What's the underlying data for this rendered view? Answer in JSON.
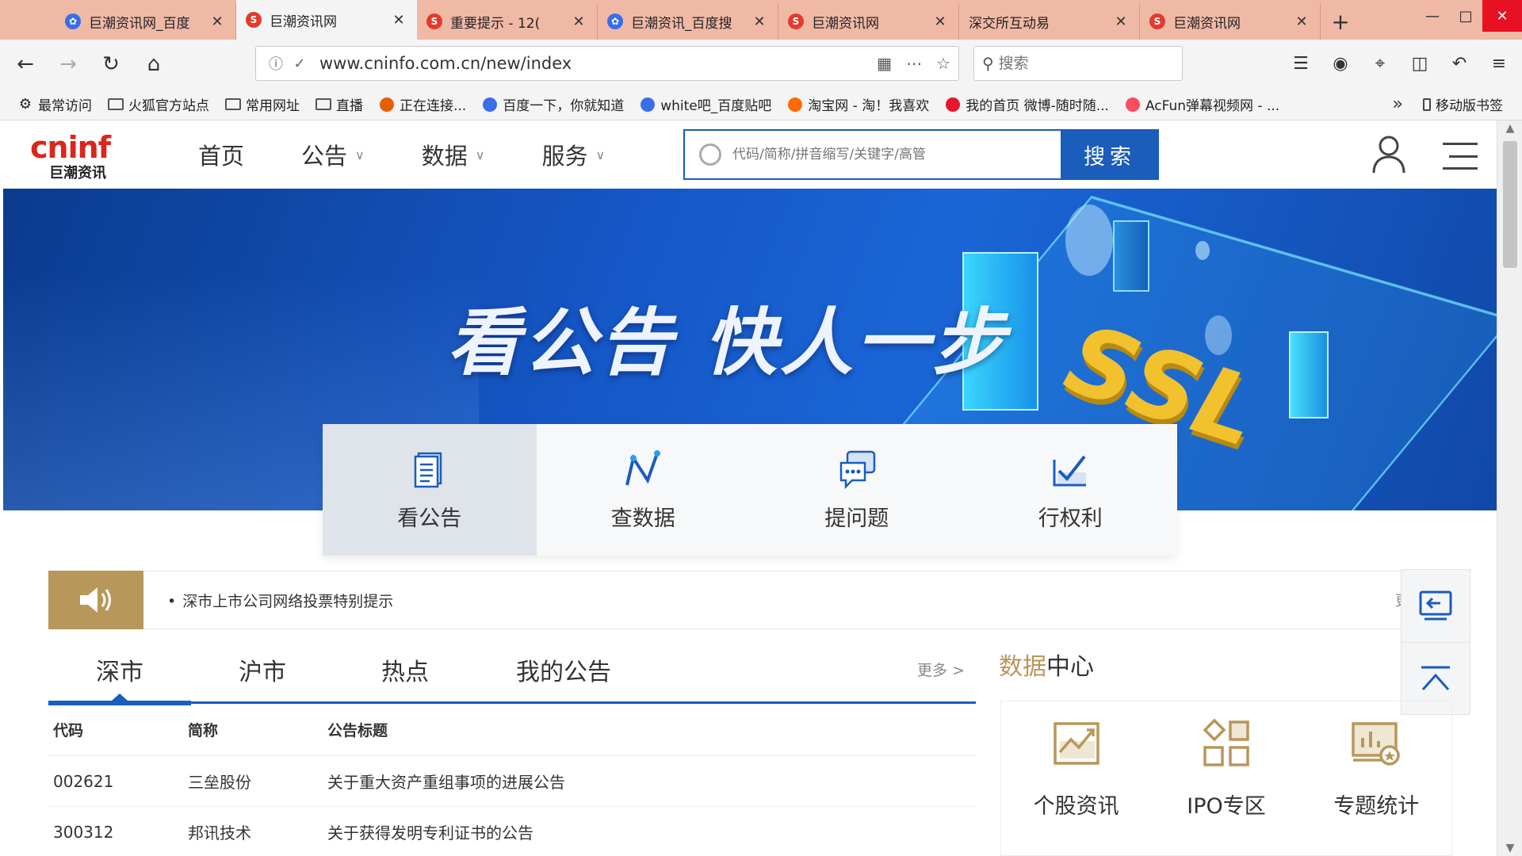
{
  "browser": {
    "tabs": [
      {
        "title": "巨潮资讯网_百度",
        "icon": "baidu",
        "active": false
      },
      {
        "title": "巨潮资讯网",
        "icon": "cninfo",
        "active": true
      },
      {
        "title": "重要提示 - 12(",
        "icon": "cninfo",
        "active": false
      },
      {
        "title": "巨潮资讯_百度搜",
        "icon": "baidu",
        "active": false
      },
      {
        "title": "巨潮资讯网",
        "icon": "cninfo",
        "active": false
      },
      {
        "title": "深交所互动易",
        "icon": "none",
        "active": false
      },
      {
        "title": "巨潮资讯网",
        "icon": "cninfo",
        "active": false
      }
    ],
    "new_tab": "+",
    "url": "www.cninfo.com.cn/new/index",
    "search_placeholder": "搜索",
    "bookmarks": [
      {
        "label": "最常访问",
        "icon": "gear"
      },
      {
        "label": "火狐官方站点",
        "icon": "folder"
      },
      {
        "label": "常用网址",
        "icon": "folder"
      },
      {
        "label": "直播",
        "icon": "folder"
      },
      {
        "label": "正在连接...",
        "icon": "firefox"
      },
      {
        "label": "百度一下，你就知道",
        "icon": "baidu"
      },
      {
        "label": "white吧_百度贴吧",
        "icon": "baidu"
      },
      {
        "label": "淘宝网 - 淘！我喜欢",
        "icon": "taobao"
      },
      {
        "label": "我的首页 微博-随时随...",
        "icon": "weibo"
      },
      {
        "label": "AcFun弹幕视频网 - ...",
        "icon": "acfun"
      }
    ],
    "bookmarks_more": "»",
    "mobile_bookmarks": "移动版书签"
  },
  "site": {
    "logo_main": "cninf",
    "logo_sub": "巨潮资讯",
    "nav": [
      {
        "label": "首页",
        "has_dropdown": false
      },
      {
        "label": "公告",
        "has_dropdown": true
      },
      {
        "label": "数据",
        "has_dropdown": true
      },
      {
        "label": "服务",
        "has_dropdown": true
      }
    ],
    "search_placeholder": "代码/简称/拼音缩写/关键字/高管",
    "search_button": "搜索"
  },
  "banner": {
    "slogan": "看公告  快人一步",
    "badge": "SSL"
  },
  "quick_links": [
    {
      "label": "看公告",
      "icon": "document-icon",
      "active": true
    },
    {
      "label": "查数据",
      "icon": "chart-line-icon",
      "active": false
    },
    {
      "label": "提问题",
      "icon": "chat-icon",
      "active": false
    },
    {
      "label": "行权利",
      "icon": "vote-check-icon",
      "active": false
    }
  ],
  "notice": {
    "text": "深市上市公司网络投票特别提示",
    "more": "更"
  },
  "announcement_tabs": {
    "tabs": [
      "深市",
      "沪市",
      "热点",
      "我的公告"
    ],
    "active_index": 0,
    "more": "更多 >"
  },
  "table": {
    "headers": [
      "代码",
      "简称",
      "公告标题"
    ],
    "rows": [
      [
        "002621",
        "三垒股份",
        "关于重大资产重组事项的进展公告"
      ],
      [
        "300312",
        "邦讯技术",
        "关于获得发明专利证书的公告"
      ]
    ]
  },
  "data_center": {
    "title_highlight": "数据",
    "title_rest": "中心",
    "items": [
      {
        "label": "个股资讯",
        "icon": "stock-chart-icon"
      },
      {
        "label": "IPO专区",
        "icon": "grid-diamond-icon"
      },
      {
        "label": "专题统计",
        "icon": "stats-badge-icon"
      }
    ]
  },
  "colors": {
    "brand_blue": "#1a5dbb",
    "brand_red": "#d9271c",
    "accent_gold": "#b8975a",
    "tabbar": "#f0b9a6"
  }
}
